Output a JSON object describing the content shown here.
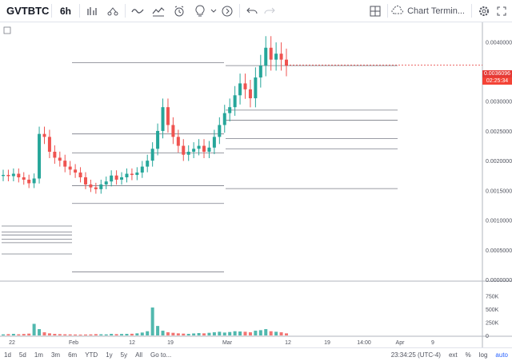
{
  "toolbar": {
    "symbol": "GVTBTC",
    "interval": "6h",
    "layout_name": "Chart Termin...",
    "icons": [
      "compare-icon",
      "indicators-icon",
      "chart-type-icon",
      "templates-icon",
      "alert-icon",
      "lightbulb-icon",
      "chevron-down-icon",
      "replay-icon",
      "undo-icon",
      "redo-icon",
      "layout-grid-icon",
      "cloud-save-icon",
      "gear-icon",
      "fullscreen-icon"
    ]
  },
  "price_axis": {
    "labels": [
      "0.0040000",
      "0.0030000",
      "0.0025000",
      "0.0020000",
      "0.0015000",
      "0.0010000",
      "0.0005000",
      "0.0000000"
    ],
    "current_price": "0.0036096",
    "countdown": "02:25:34"
  },
  "volume_axis": {
    "labels": [
      "750K",
      "500K",
      "250K",
      "0"
    ]
  },
  "time_axis": {
    "labels": [
      "22",
      "Feb",
      "12",
      "19",
      "Mar",
      "12",
      "19",
      "14:00",
      "Apr",
      "9"
    ]
  },
  "bottom_bar": {
    "ranges": [
      "1d",
      "5d",
      "1m",
      "3m",
      "6m",
      "YTD",
      "1y",
      "5y",
      "All"
    ],
    "goto": "Go to...",
    "clock": "23:34:25 (UTC-4)",
    "options": [
      "ext",
      "%",
      "log",
      "auto"
    ]
  },
  "colors": {
    "up": "#26a69a",
    "down": "#ef5350",
    "price_tag": "#e53935",
    "auto": "#2962ff"
  },
  "chart_data": {
    "type": "candlestick",
    "closes": [
      0.00176,
      0.00174,
      0.00178,
      0.00172,
      0.00168,
      0.00162,
      0.0017,
      0.00245,
      0.0024,
      0.00215,
      0.00205,
      0.002,
      0.0019,
      0.00185,
      0.0018,
      0.00172,
      0.0016,
      0.00155,
      0.00152,
      0.0016,
      0.00165,
      0.00175,
      0.00168,
      0.00172,
      0.00178,
      0.00176,
      0.0018,
      0.0019,
      0.002,
      0.0022,
      0.0025,
      0.0029,
      0.0026,
      0.0024,
      0.00225,
      0.0021,
      0.00215,
      0.0022,
      0.00225,
      0.00215,
      0.00222,
      0.0024,
      0.0026,
      0.0028,
      0.0029,
      0.0031,
      0.0033,
      0.0032,
      0.00305,
      0.0034,
      0.0036,
      0.0039,
      0.0037,
      0.0038,
      0.0037,
      0.0036
    ],
    "volume": [
      20,
      25,
      30,
      22,
      28,
      35,
      220,
      120,
      60,
      40,
      30,
      25,
      22,
      20,
      18,
      16,
      18,
      20,
      25,
      22,
      20,
      30,
      25,
      28,
      30,
      32,
      40,
      55,
      80,
      530,
      180,
      90,
      60,
      50,
      40,
      35,
      30,
      38,
      45,
      40,
      50,
      60,
      70,
      55,
      65,
      80,
      75,
      70,
      60,
      90,
      100,
      120,
      80,
      70,
      60,
      40
    ],
    "ylim": [
      0,
      0.0043
    ],
    "current_price": 0.0036096
  }
}
